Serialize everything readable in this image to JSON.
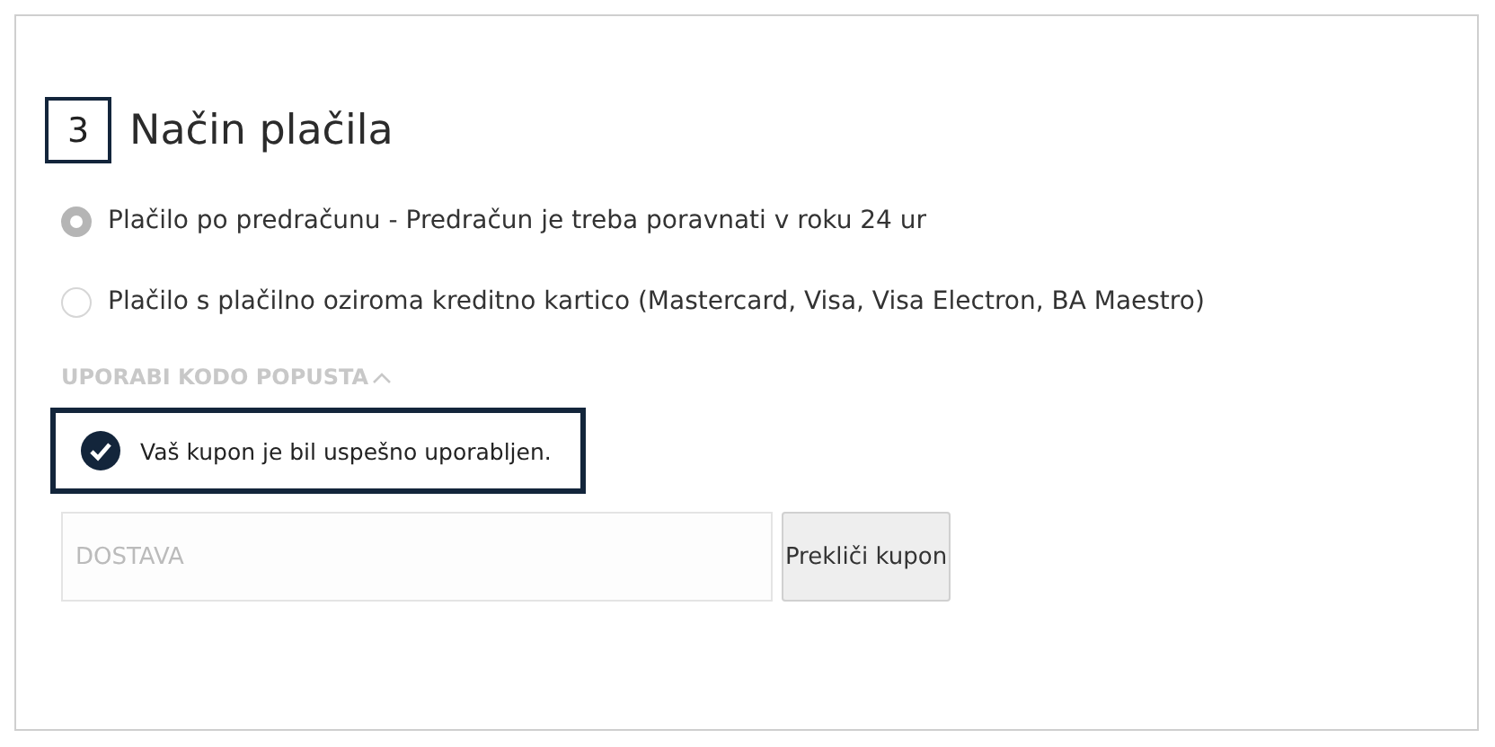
{
  "section": {
    "number": "3",
    "title": "Način plačila"
  },
  "payment_options": [
    {
      "label": "Plačilo po predračunu - Predračun je treba poravnati v roku 24 ur",
      "selected": true
    },
    {
      "label": "Plačilo s plačilno oziroma kreditno kartico (Mastercard, Visa, Visa Electron, BA Maestro)",
      "selected": false
    }
  ],
  "coupon": {
    "toggle_label": "UPORABI KODO POPUSTA",
    "expanded": true,
    "success_message": "Vaš kupon je bil uspešno uporabljen.",
    "field": {
      "value": "DOSTAVA",
      "disabled": true
    },
    "button": "Prekliči kupon"
  }
}
